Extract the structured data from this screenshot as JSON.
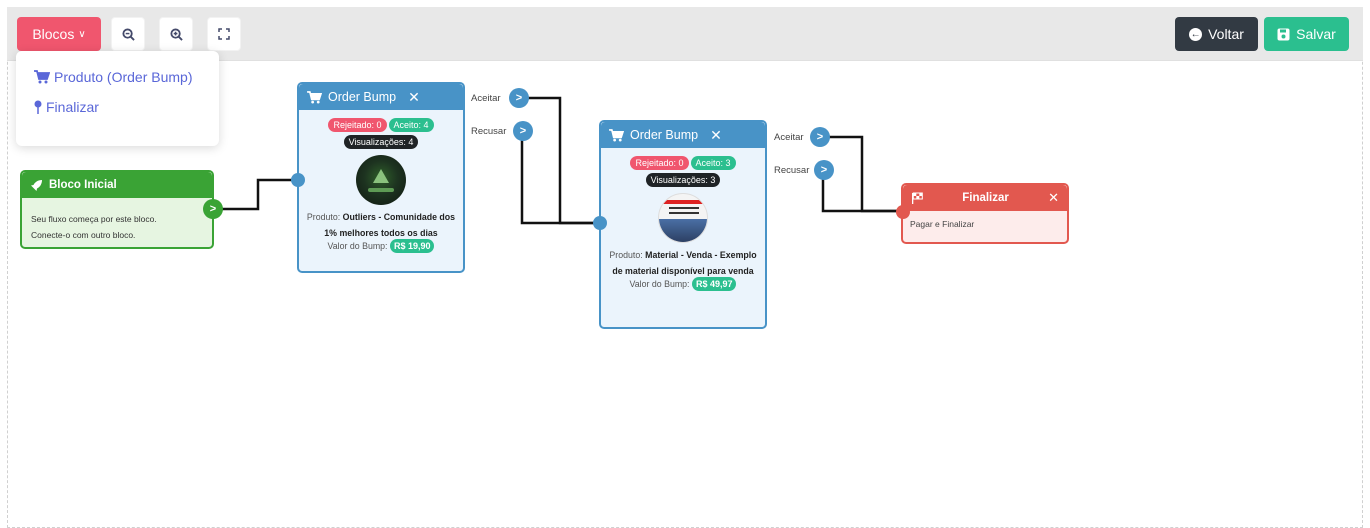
{
  "toolbar": {
    "blocos_label": "Blocos",
    "voltar_label": "Voltar",
    "salvar_label": "Salvar"
  },
  "dropdown": {
    "items": [
      {
        "label": "Produto (Order Bump)",
        "icon": "cart-icon"
      },
      {
        "label": "Finalizar",
        "icon": "pin-icon"
      }
    ]
  },
  "nodes": {
    "inicial": {
      "title": "Bloco Inicial",
      "line1": "Seu fluxo começa por este bloco.",
      "line2": "Conecte-o com outro bloco."
    },
    "order_bump_1": {
      "title": "Order Bump",
      "rejeitado": "Rejeitado: 0",
      "aceito": "Aceito: 4",
      "visualizacoes": "Visualizações: 4",
      "produto_prefix": "Produto:",
      "produto_name": "Outliers - Comunidade dos 1% melhores todos os dias",
      "valor_label": "Valor do Bump:",
      "valor": "R$ 19,90"
    },
    "order_bump_2": {
      "title": "Order Bump",
      "rejeitado": "Rejeitado: 0",
      "aceito": "Aceito: 3",
      "visualizacoes": "Visualizações: 3",
      "produto_prefix": "Produto:",
      "produto_name": "Material - Venda - Exemplo de material disponível para venda",
      "valor_label": "Valor do Bump:",
      "valor": "R$ 49,97"
    },
    "finalizar": {
      "title": "Finalizar",
      "body": "Pagar e Finalizar"
    }
  },
  "ports": {
    "aceitar": "Aceitar",
    "recusar": "Recusar"
  },
  "colors": {
    "pink": "#f0566e",
    "green": "#2bbf8f",
    "dark": "#323a43",
    "blue": "#4893c7",
    "red": "#e2584f",
    "start_green": "#3aa335"
  }
}
